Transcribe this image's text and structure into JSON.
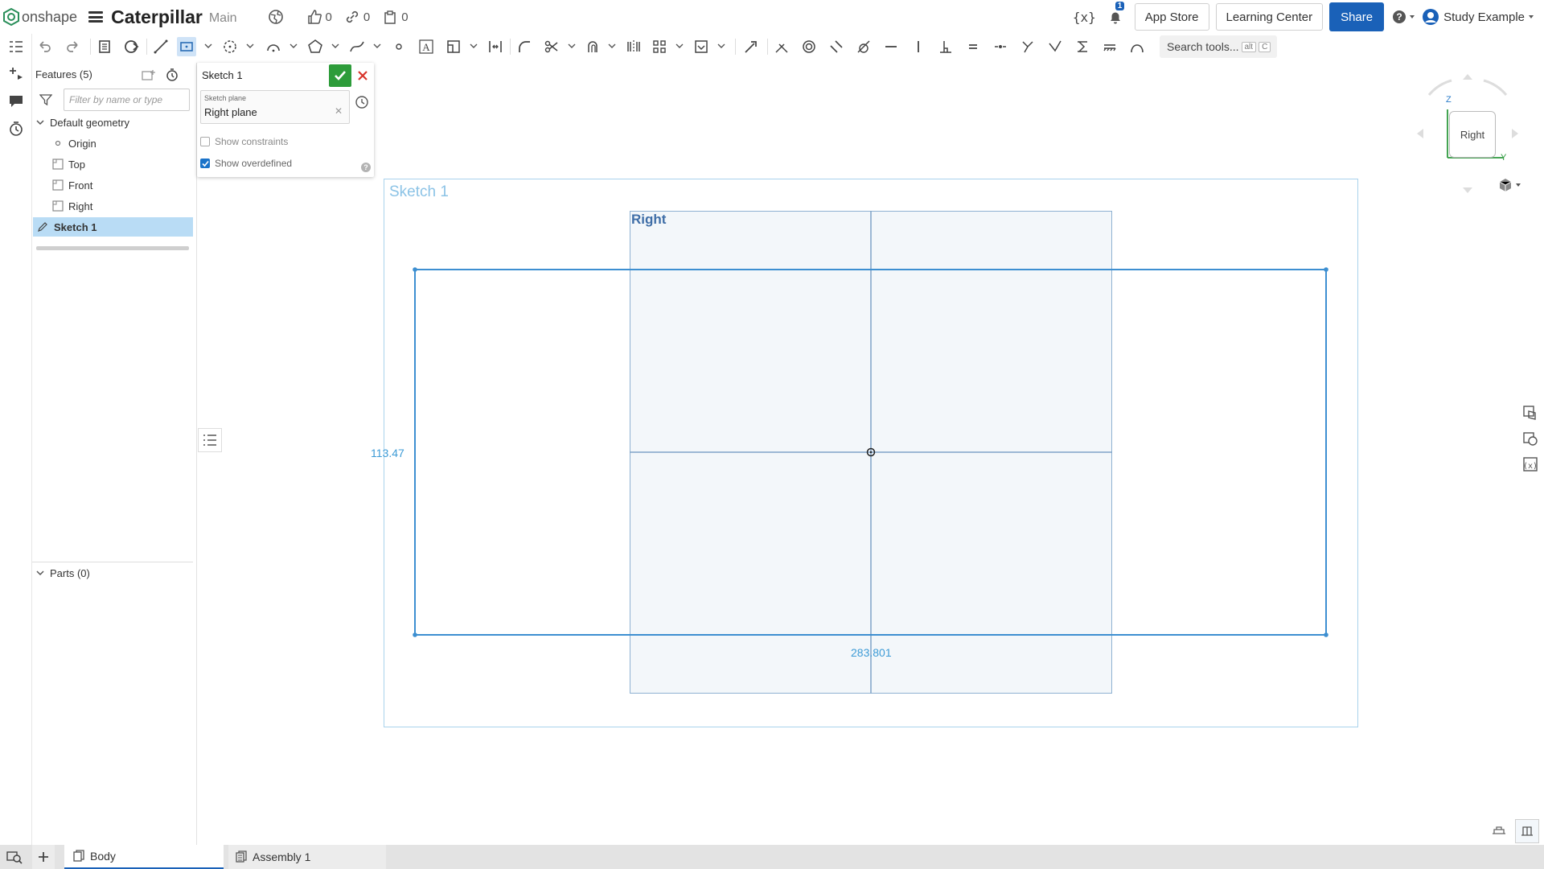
{
  "header": {
    "logo_text": "onshape",
    "doc_title": "Caterpillar",
    "branch": "Main",
    "likes": "0",
    "links": "0",
    "copies": "0",
    "notification_count": "1",
    "app_store": "App Store",
    "learning_center": "Learning Center",
    "share": "Share",
    "user": "Study Example"
  },
  "toolbar": {
    "search_label": "Search tools...",
    "search_kbd_1": "alt",
    "search_kbd_2": "C"
  },
  "features": {
    "title": "Features (5)",
    "filter_placeholder": "Filter by name or type",
    "default_geometry": "Default geometry",
    "items": [
      "Origin",
      "Top",
      "Front",
      "Right"
    ],
    "sketch": "Sketch 1",
    "parts": "Parts (0)"
  },
  "dialog": {
    "title": "Sketch 1",
    "plane_caption": "Sketch plane",
    "plane_value": "Right plane",
    "show_constraints": "Show constraints",
    "show_overdefined": "Show overdefined",
    "help": "?"
  },
  "canvas": {
    "sketch_label": "Sketch 1",
    "plane_label": "Right",
    "dim_height": "113.47",
    "dim_width": "283.801"
  },
  "viewcube": {
    "face": "Right",
    "axis_z": "Z",
    "axis_y": "Y"
  },
  "tabs": {
    "body": "Body",
    "assembly": "Assembly 1"
  },
  "colors": {
    "accent": "#1a61b8",
    "confirm": "#2d9c3a",
    "sketch_line": "#3d8fd1"
  }
}
